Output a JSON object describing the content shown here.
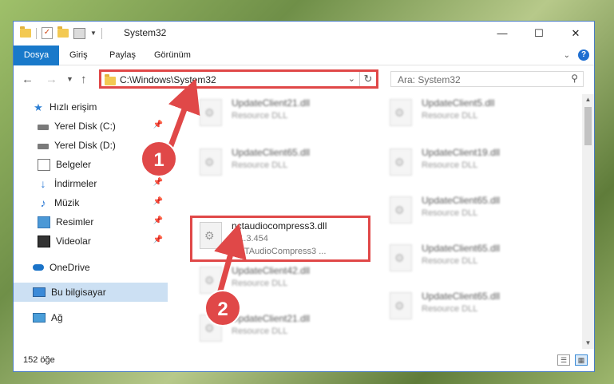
{
  "window": {
    "title": "System32",
    "controls": {
      "minimize": "—",
      "maximize": "☐",
      "close": "✕"
    }
  },
  "ribbon": {
    "tabs": [
      "Dosya",
      "Giriş",
      "Paylaş",
      "Görünüm"
    ],
    "help": "?"
  },
  "address": {
    "path": "C:\\Windows\\System32",
    "search_placeholder": "Ara: System32"
  },
  "sidebar": {
    "items": [
      {
        "label": "Hızlı erişim",
        "icon": "star-icon"
      },
      {
        "label": "Yerel Disk (C:)",
        "icon": "drive-icon",
        "pinned": true
      },
      {
        "label": "Yerel Disk (D:)",
        "icon": "drive-icon"
      },
      {
        "label": "Belgeler",
        "icon": "documents-icon",
        "pinned": true
      },
      {
        "label": "İndirmeler",
        "icon": "downloads-icon",
        "pinned": true
      },
      {
        "label": "Müzik",
        "icon": "music-icon",
        "pinned": true
      },
      {
        "label": "Resimler",
        "icon": "pictures-icon",
        "pinned": true
      },
      {
        "label": "Videolar",
        "icon": "videos-icon",
        "pinned": true
      },
      {
        "label": "OneDrive",
        "icon": "cloud-icon"
      },
      {
        "label": "Bu bilgisayar",
        "icon": "computer-icon",
        "selected": true
      },
      {
        "label": "Ağ",
        "icon": "network-icon"
      }
    ]
  },
  "files": {
    "left": [
      {
        "name": "UpdateClient21.dll",
        "desc": "Resource DLL"
      },
      {
        "name": "UpdateClient65.dll",
        "desc": "Resource DLL"
      },
      {
        "name": "UpdateClient42.dll",
        "desc": "Resource DLL"
      },
      {
        "name": "UpdateClient21.dll",
        "desc": "Resource DLL"
      }
    ],
    "right": [
      {
        "name": "UpdateClient5.dll",
        "desc": "Resource DLL"
      },
      {
        "name": "UpdateClient19.dll",
        "desc": "Resource DLL"
      },
      {
        "name": "UpdateClient65.dll",
        "desc": "Resource DLL"
      },
      {
        "name": "UpdateClient65.dll",
        "desc": "Resource DLL"
      },
      {
        "name": "UpdateClient65.dll",
        "desc": "Resource DLL"
      }
    ],
    "highlighted": {
      "name": "nctaudiocompress3.dll",
      "version": "1.1.3.454",
      "company": "NCTAudioCompress3 ..."
    }
  },
  "status": {
    "count": "152 öğe"
  },
  "annotations": {
    "step1": "1",
    "step2": "2",
    "color": "#e04848"
  }
}
